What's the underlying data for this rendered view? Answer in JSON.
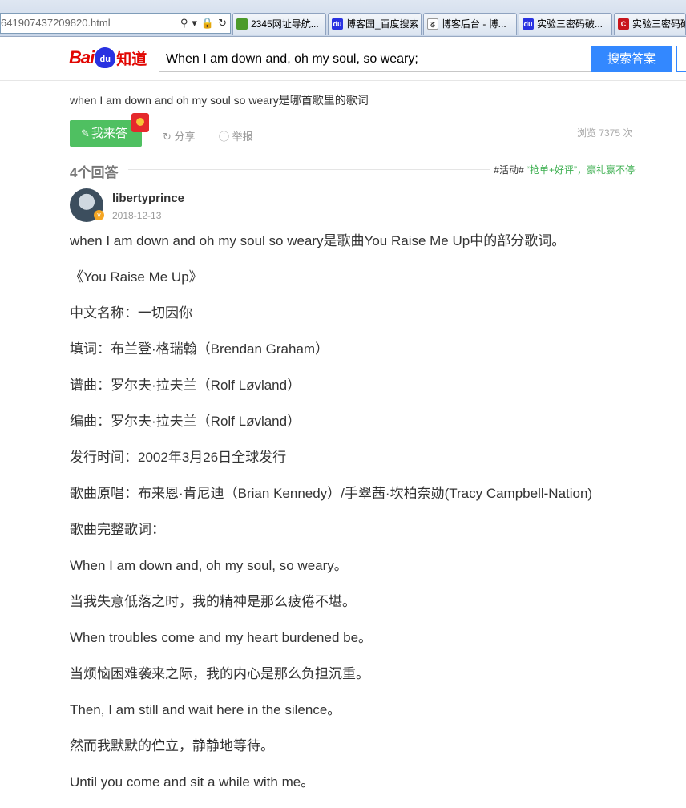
{
  "browser": {
    "address": "641907437209820.html",
    "tabs": [
      {
        "label": "2345网址导航...",
        "icon_color": "#4c9a2a",
        "icon_text": "2345"
      },
      {
        "label": "博客园_百度搜索",
        "icon_color": "#2932e1",
        "icon_text": "du"
      },
      {
        "label": "博客后台 - 博...",
        "icon_color": "#ffffff",
        "icon_text": "ᘔ"
      },
      {
        "label": "实验三密码破...",
        "icon_color": "#2932e1",
        "icon_text": "du"
      },
      {
        "label": "实验三密码破",
        "icon_color": "#c8161d",
        "icon_text": "C"
      }
    ]
  },
  "header": {
    "logo_bai": "Bai",
    "logo_du": "du",
    "logo_zhidao": "知道",
    "search_value": "When I am down and, oh my soul, so weary;",
    "search_button": "搜索答案"
  },
  "question": {
    "title": "when I am down and oh my soul so weary是哪首歌里的歌词",
    "answer_button": "我来答",
    "share": "分享",
    "report": "举报",
    "views": "浏览 7375 次",
    "answer_count": "4个回答",
    "promo_tag": "#活动#",
    "promo_text": "“抢单+好评”，豪礼赢不停"
  },
  "answer": {
    "user": "libertyprince",
    "date": "2018-12-13",
    "badge": "v",
    "paragraphs": [
      "when I am down and oh my soul so weary是歌曲You Raise Me Up中的部分歌词。",
      "《You Raise Me Up》",
      "中文名称：一切因你",
      "填词：布兰登·格瑞翰（Brendan Graham）",
      "谱曲：罗尔夫·拉夫兰（Rolf Løvland）",
      "编曲：罗尔夫·拉夫兰（Rolf Løvland）",
      "发行时间：2002年3月26日全球发行",
      "歌曲原唱：布来恩·肯尼迪（Brian Kennedy）/手翠茜·坎柏奈勋(Tracy Campbell-Nation)",
      "歌曲完整歌词：",
      "When I am down and, oh my soul, so weary。",
      "当我失意低落之时，我的精神是那么疲倦不堪。",
      "When troubles come and my heart burdened be。",
      "当烦恼困难袭来之际，我的内心是那么负担沉重。",
      "Then, I am still and wait here in the silence。",
      "然而我默默的伫立，静静地等待。",
      "Until you come and sit a while with me。"
    ]
  }
}
